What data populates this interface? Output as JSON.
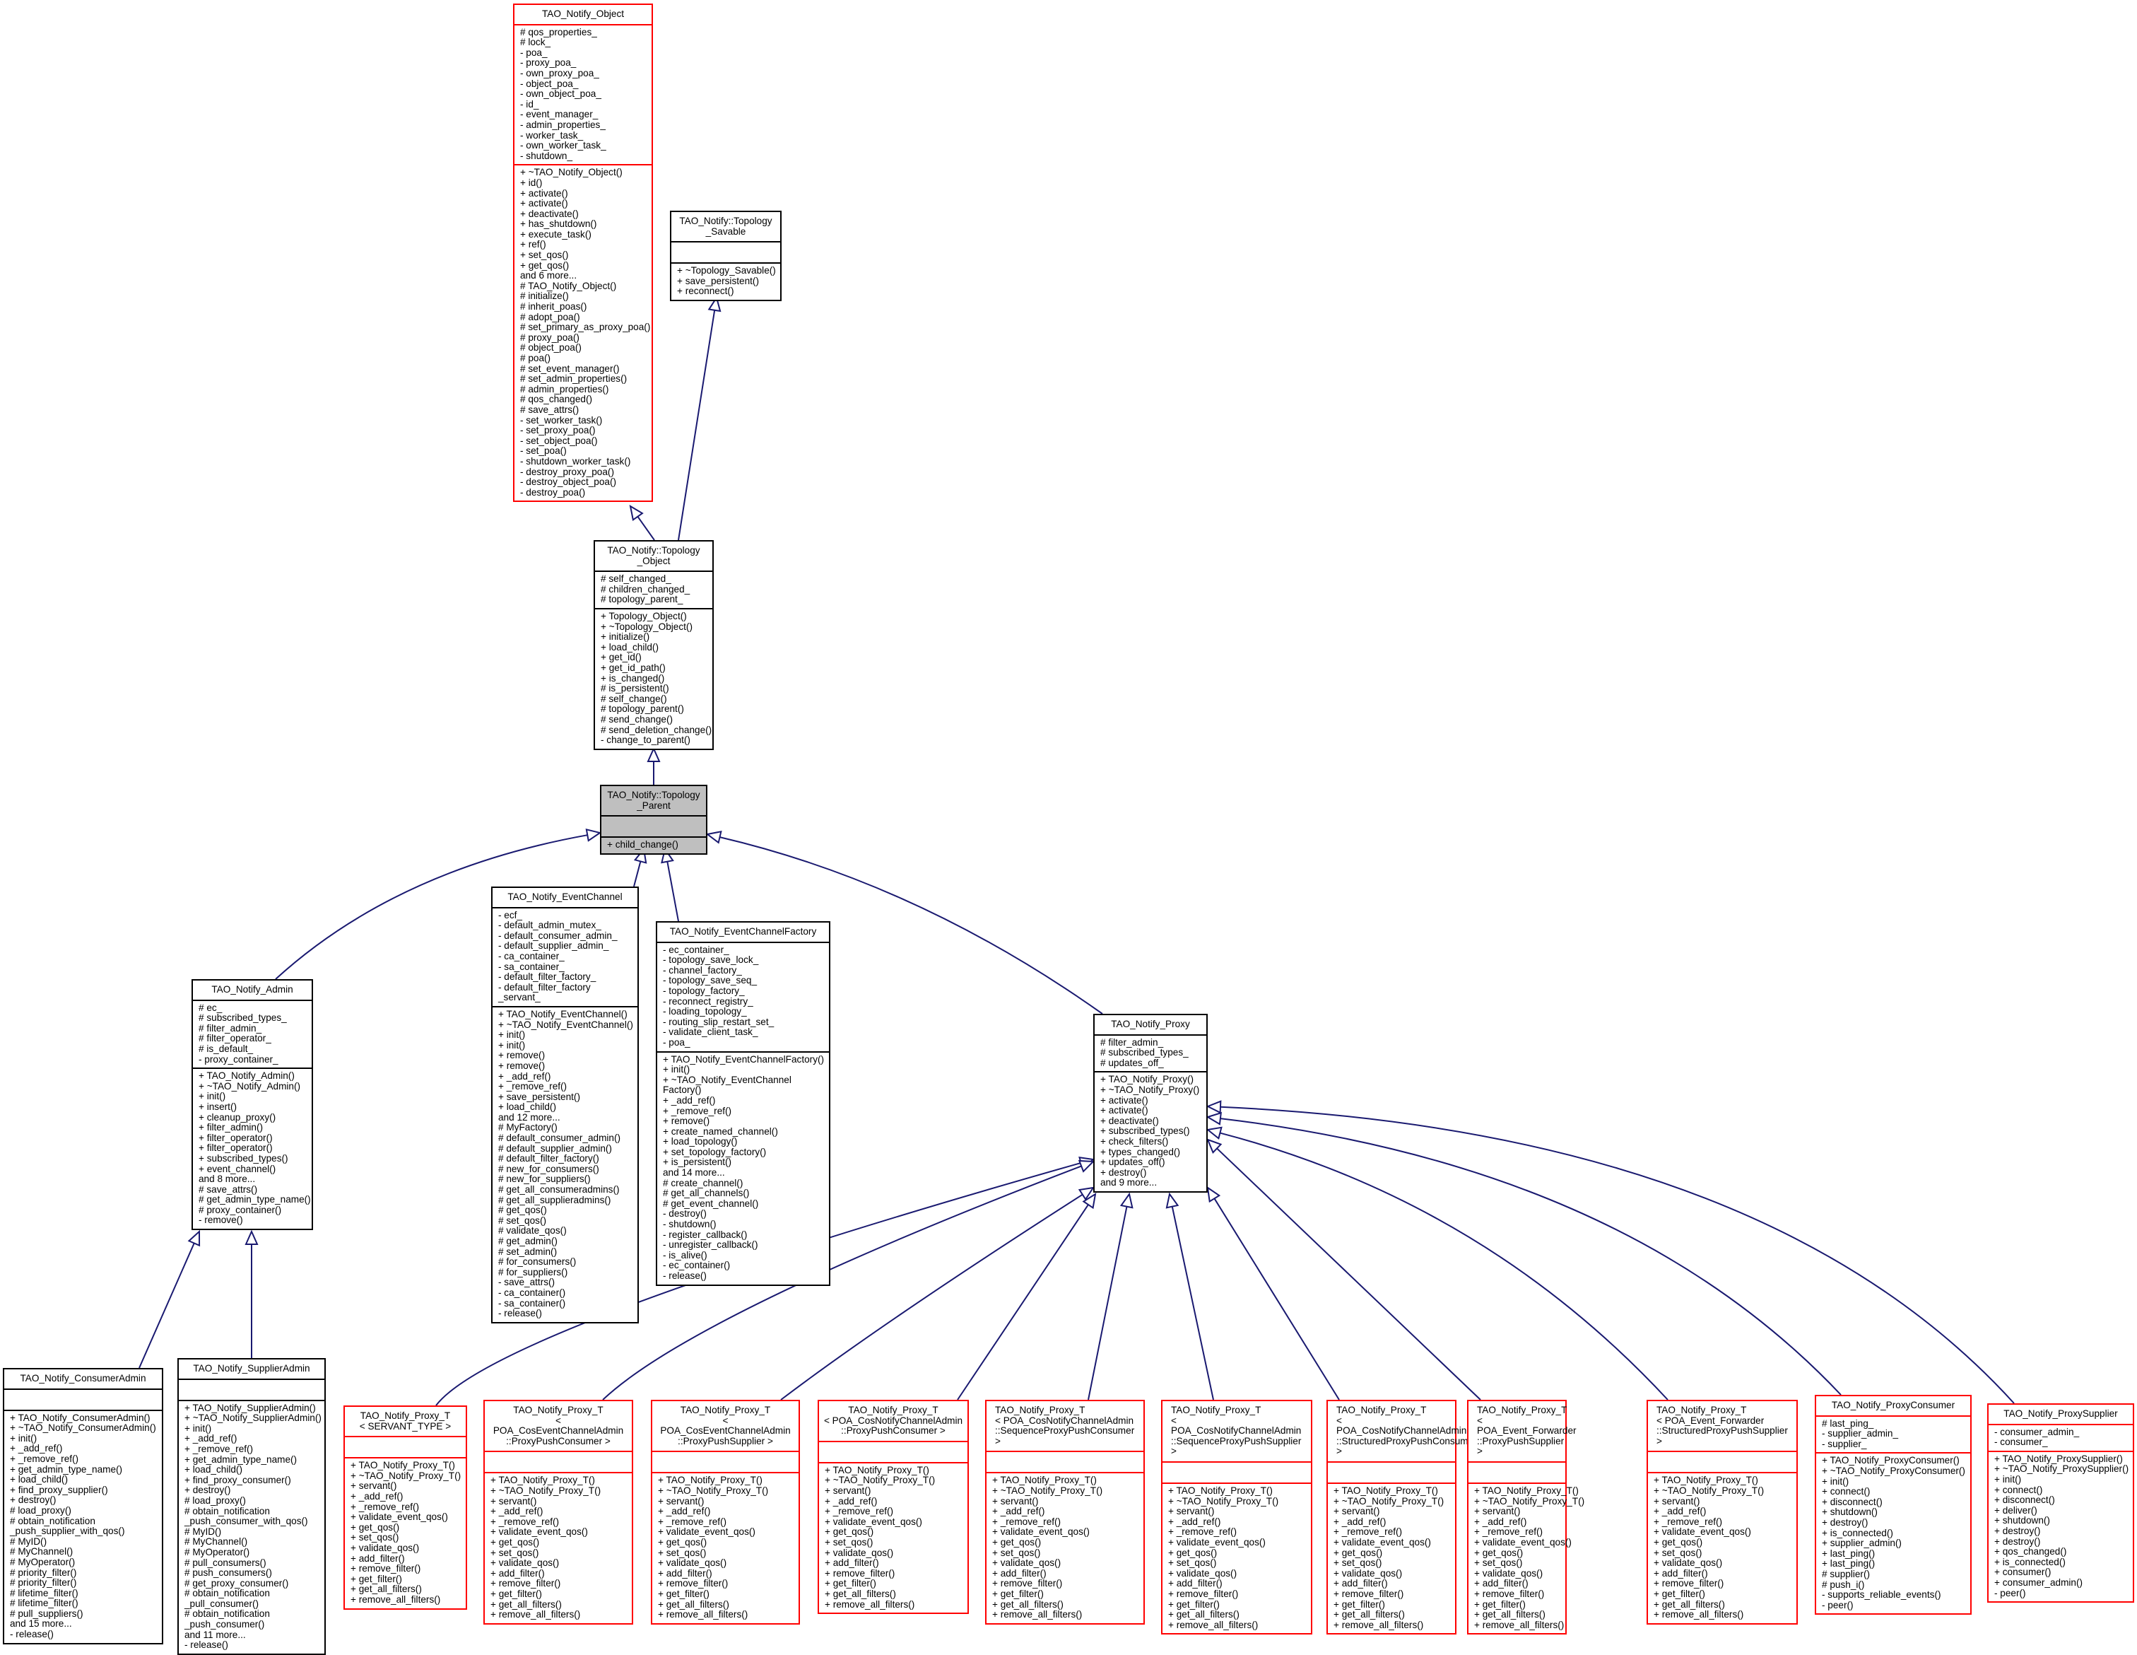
{
  "diagram_title": "Inheritance diagram for TAO_Notify::Topology_Parent",
  "colors": {
    "edge": "#191970",
    "incomplete_border": "#ff0000",
    "complete_border": "#000000",
    "focus_fill": "#bfbfbf"
  },
  "classes": {
    "notify_object": {
      "title": [
        "TAO_Notify_Object"
      ],
      "attributes": [
        "# qos_properties_",
        "# lock_",
        "- poa_",
        "- proxy_poa_",
        "- own_proxy_poa_",
        "- object_poa_",
        "- own_object_poa_",
        "- id_",
        "- event_manager_",
        "- admin_properties_",
        "- worker_task_",
        "- own_worker_task_",
        "- shutdown_"
      ],
      "methods": [
        "+ ~TAO_Notify_Object()",
        "+ id()",
        "+ activate()",
        "+ activate()",
        "+ deactivate()",
        "+ has_shutdown()",
        "+ execute_task()",
        "+ ref()",
        "+ set_qos()",
        "+ get_qos()",
        "and 6 more...",
        "# TAO_Notify_Object()",
        "# initialize()",
        "# inherit_poas()",
        "# adopt_poa()",
        "# set_primary_as_proxy_poa()",
        "# proxy_poa()",
        "# object_poa()",
        "# poa()",
        "# set_event_manager()",
        "# set_admin_properties()",
        "# admin_properties()",
        "# qos_changed()",
        "# save_attrs()",
        "- set_worker_task()",
        "- set_proxy_poa()",
        "- set_object_poa()",
        "- set_poa()",
        "- shutdown_worker_task()",
        "- destroy_proxy_poa()",
        "- destroy_object_poa()",
        "- destroy_poa()"
      ]
    },
    "topology_savable": {
      "title": [
        "TAO_Notify::Topology",
        "_Savable"
      ],
      "attributes": [],
      "methods": [
        "+ ~Topology_Savable()",
        "+ save_persistent()",
        "+ reconnect()"
      ]
    },
    "topology_object": {
      "title": [
        "TAO_Notify::Topology",
        "_Object"
      ],
      "attributes": [
        "# self_changed_",
        "# children_changed_",
        "# topology_parent_"
      ],
      "methods": [
        "+ Topology_Object()",
        "+ ~Topology_Object()",
        "+ initialize()",
        "+ load_child()",
        "+ get_id()",
        "+ get_id_path()",
        "+ is_changed()",
        "# is_persistent()",
        "# self_change()",
        "# topology_parent()",
        "# send_change()",
        "# send_deletion_change()",
        "- change_to_parent()"
      ]
    },
    "topology_parent": {
      "title": [
        "TAO_Notify::Topology",
        "_Parent"
      ],
      "attributes": [],
      "methods": [
        "+ child_change()"
      ]
    },
    "event_channel": {
      "title": [
        "TAO_Notify_EventChannel"
      ],
      "attributes": [
        "- ecf_",
        "- default_admin_mutex_",
        "- default_consumer_admin_",
        "- default_supplier_admin_",
        "- ca_container_",
        "- sa_container_",
        "- default_filter_factory_",
        "- default_filter_factory",
        "_servant_"
      ],
      "methods": [
        "+ TAO_Notify_EventChannel()",
        "+ ~TAO_Notify_EventChannel()",
        "+ init()",
        "+ init()",
        "+ remove()",
        "+ remove()",
        "+ _add_ref()",
        "+ _remove_ref()",
        "+ save_persistent()",
        "+ load_child()",
        "and 12 more...",
        "# MyFactory()",
        "# default_consumer_admin()",
        "# default_supplier_admin()",
        "# default_filter_factory()",
        "# new_for_consumers()",
        "# new_for_suppliers()",
        "# get_all_consumeradmins()",
        "# get_all_supplieradmins()",
        "# get_qos()",
        "# set_qos()",
        "# validate_qos()",
        "# get_admin()",
        "# set_admin()",
        "# for_consumers()",
        "# for_suppliers()",
        "- save_attrs()",
        "- ca_container()",
        "- sa_container()",
        "- release()"
      ]
    },
    "event_channel_factory": {
      "title": [
        "TAO_Notify_EventChannelFactory"
      ],
      "attributes": [
        "- ec_container_",
        "- topology_save_lock_",
        "- channel_factory_",
        "- topology_save_seq_",
        "- topology_factory_",
        "- reconnect_registry_",
        "- loading_topology_",
        "- routing_slip_restart_set_",
        "- validate_client_task_",
        "- poa_"
      ],
      "methods": [
        "+ TAO_Notify_EventChannelFactory()",
        "+ init()",
        "+ ~TAO_Notify_EventChannel",
        "Factory()",
        "+ _add_ref()",
        "+ _remove_ref()",
        "+ remove()",
        "+ create_named_channel()",
        "+ load_topology()",
        "+ set_topology_factory()",
        "+ is_persistent()",
        "and 14 more...",
        "# create_channel()",
        "# get_all_channels()",
        "# get_event_channel()",
        "- destroy()",
        "- shutdown()",
        "- register_callback()",
        "- unregister_callback()",
        "- is_alive()",
        "- ec_container()",
        "- release()"
      ]
    },
    "admin": {
      "title": [
        "TAO_Notify_Admin"
      ],
      "attributes": [
        "# ec_",
        "# subscribed_types_",
        "# filter_admin_",
        "# filter_operator_",
        "# is_default_",
        "- proxy_container_"
      ],
      "methods": [
        "+ TAO_Notify_Admin()",
        "+ ~TAO_Notify_Admin()",
        "+ init()",
        "+ insert()",
        "+ cleanup_proxy()",
        "+ filter_admin()",
        "+ filter_operator()",
        "+ filter_operator()",
        "+ subscribed_types()",
        "+ event_channel()",
        "and 8 more...",
        "# save_attrs()",
        "# get_admin_type_name()",
        "# proxy_container()",
        "- remove()"
      ]
    },
    "consumer_admin": {
      "title": [
        "TAO_Notify_ConsumerAdmin"
      ],
      "attributes": [],
      "methods": [
        "+ TAO_Notify_ConsumerAdmin()",
        "+ ~TAO_Notify_ConsumerAdmin()",
        "+ init()",
        "+ _add_ref()",
        "+ _remove_ref()",
        "+ get_admin_type_name()",
        "+ load_child()",
        "+ find_proxy_supplier()",
        "+ destroy()",
        "# load_proxy()",
        "# obtain_notification",
        "_push_supplier_with_qos()",
        "# MyID()",
        "# MyChannel()",
        "# MyOperator()",
        "# priority_filter()",
        "# priority_filter()",
        "# lifetime_filter()",
        "# lifetime_filter()",
        "# pull_suppliers()",
        "and 15 more...",
        "- release()"
      ]
    },
    "supplier_admin": {
      "title": [
        "TAO_Notify_SupplierAdmin"
      ],
      "attributes": [],
      "methods": [
        "+ TAO_Notify_SupplierAdmin()",
        "+ ~TAO_Notify_SupplierAdmin()",
        "+ init()",
        "+ _add_ref()",
        "+ _remove_ref()",
        "+ get_admin_type_name()",
        "+ load_child()",
        "+ find_proxy_consumer()",
        "+ destroy()",
        "# load_proxy()",
        "# obtain_notification",
        "_push_consumer_with_qos()",
        "# MyID()",
        "# MyChannel()",
        "# MyOperator()",
        "# pull_consumers()",
        "# push_consumers()",
        "# get_proxy_consumer()",
        "# obtain_notification",
        "_pull_consumer()",
        "# obtain_notification",
        "_push_consumer()",
        "and 11 more...",
        "- release()"
      ]
    },
    "proxy": {
      "title": [
        "TAO_Notify_Proxy"
      ],
      "attributes": [
        "# filter_admin_",
        "# subscribed_types_",
        "# updates_off_"
      ],
      "methods": [
        "+ TAO_Notify_Proxy()",
        "+ ~TAO_Notify_Proxy()",
        "+ activate()",
        "+ activate()",
        "+ deactivate()",
        "+ subscribed_types()",
        "+ check_filters()",
        "+ types_changed()",
        "+ updates_off()",
        "+ destroy()",
        "and 9 more..."
      ]
    },
    "proxy_t_servant": {
      "title": [
        "TAO_Notify_Proxy_T",
        "< SERVANT_TYPE >"
      ],
      "attributes": [],
      "methods": [
        "+ TAO_Notify_Proxy_T()",
        "+ ~TAO_Notify_Proxy_T()",
        "+ servant()",
        "+ _add_ref()",
        "+ _remove_ref()",
        "+ validate_event_qos()",
        "+ get_qos()",
        "+ set_qos()",
        "+ validate_qos()",
        "+ add_filter()",
        "+ remove_filter()",
        "+ get_filter()",
        "+ get_all_filters()",
        "+ remove_all_filters()"
      ]
    },
    "proxy_t_cosevent_ppc": {
      "title": [
        "TAO_Notify_Proxy_T",
        "< POA_CosEventChannelAdmin",
        "::ProxyPushConsumer >"
      ],
      "attributes": [],
      "methods": [
        "+ TAO_Notify_Proxy_T()",
        "+ ~TAO_Notify_Proxy_T()",
        "+ servant()",
        "+ _add_ref()",
        "+ _remove_ref()",
        "+ validate_event_qos()",
        "+ get_qos()",
        "+ set_qos()",
        "+ validate_qos()",
        "+ add_filter()",
        "+ remove_filter()",
        "+ get_filter()",
        "+ get_all_filters()",
        "+ remove_all_filters()"
      ]
    },
    "proxy_t_cosevent_pps": {
      "title": [
        "TAO_Notify_Proxy_T",
        "< POA_CosEventChannelAdmin",
        "::ProxyPushSupplier >"
      ],
      "attributes": [],
      "methods": [
        "+ TAO_Notify_Proxy_T()",
        "+ ~TAO_Notify_Proxy_T()",
        "+ servant()",
        "+ _add_ref()",
        "+ _remove_ref()",
        "+ validate_event_qos()",
        "+ get_qos()",
        "+ set_qos()",
        "+ validate_qos()",
        "+ add_filter()",
        "+ remove_filter()",
        "+ get_filter()",
        "+ get_all_filters()",
        "+ remove_all_filters()"
      ]
    },
    "proxy_t_cosnotify_ppc": {
      "title": [
        "TAO_Notify_Proxy_T",
        "< POA_CosNotifyChannelAdmin",
        "::ProxyPushConsumer >"
      ],
      "attributes": [],
      "methods": [
        "+ TAO_Notify_Proxy_T()",
        "+ ~TAO_Notify_Proxy_T()",
        "+ servant()",
        "+ _add_ref()",
        "+ _remove_ref()",
        "+ validate_event_qos()",
        "+ get_qos()",
        "+ set_qos()",
        "+ validate_qos()",
        "+ add_filter()",
        "+ remove_filter()",
        "+ get_filter()",
        "+ get_all_filters()",
        "+ remove_all_filters()"
      ]
    },
    "proxy_t_cosnotify_sppc": {
      "title": [
        "TAO_Notify_Proxy_T",
        "< POA_CosNotifyChannelAdmin",
        "::SequenceProxyPushConsumer >"
      ],
      "attributes": [],
      "methods": [
        "+ TAO_Notify_Proxy_T()",
        "+ ~TAO_Notify_Proxy_T()",
        "+ servant()",
        "+ _add_ref()",
        "+ _remove_ref()",
        "+ validate_event_qos()",
        "+ get_qos()",
        "+ set_qos()",
        "+ validate_qos()",
        "+ add_filter()",
        "+ remove_filter()",
        "+ get_filter()",
        "+ get_all_filters()",
        "+ remove_all_filters()"
      ]
    },
    "proxy_t_cosnotify_spps": {
      "title": [
        "TAO_Notify_Proxy_T",
        "< POA_CosNotifyChannelAdmin",
        "::SequenceProxyPushSupplier >"
      ],
      "attributes": [],
      "methods": [
        "+ TAO_Notify_Proxy_T()",
        "+ ~TAO_Notify_Proxy_T()",
        "+ servant()",
        "+ _add_ref()",
        "+ _remove_ref()",
        "+ validate_event_qos()",
        "+ get_qos()",
        "+ set_qos()",
        "+ validate_qos()",
        "+ add_filter()",
        "+ remove_filter()",
        "+ get_filter()",
        "+ get_all_filters()",
        "+ remove_all_filters()"
      ]
    },
    "proxy_t_cosnotify_stppc": {
      "title": [
        "TAO_Notify_Proxy_T",
        "< POA_CosNotifyChannelAdmin",
        "::StructuredProxyPushConsumer >"
      ],
      "attributes": [],
      "methods": [
        "+ TAO_Notify_Proxy_T()",
        "+ ~TAO_Notify_Proxy_T()",
        "+ servant()",
        "+ _add_ref()",
        "+ _remove_ref()",
        "+ validate_event_qos()",
        "+ get_qos()",
        "+ set_qos()",
        "+ validate_qos()",
        "+ add_filter()",
        "+ remove_filter()",
        "+ get_filter()",
        "+ get_all_filters()",
        "+ remove_all_filters()"
      ]
    },
    "proxy_t_fwd_pps": {
      "title": [
        "TAO_Notify_Proxy_T",
        "< POA_Event_Forwarder",
        "::ProxyPushSupplier >"
      ],
      "attributes": [],
      "methods": [
        "+ TAO_Notify_Proxy_T()",
        "+ ~TAO_Notify_Proxy_T()",
        "+ servant()",
        "+ _add_ref()",
        "+ _remove_ref()",
        "+ validate_event_qos()",
        "+ get_qos()",
        "+ set_qos()",
        "+ validate_qos()",
        "+ add_filter()",
        "+ remove_filter()",
        "+ get_filter()",
        "+ get_all_filters()",
        "+ remove_all_filters()"
      ]
    },
    "proxy_t_fwd_stpps": {
      "title": [
        "TAO_Notify_Proxy_T",
        "< POA_Event_Forwarder",
        "::StructuredProxyPushSupplier >"
      ],
      "attributes": [],
      "methods": [
        "+ TAO_Notify_Proxy_T()",
        "+ ~TAO_Notify_Proxy_T()",
        "+ servant()",
        "+ _add_ref()",
        "+ _remove_ref()",
        "+ validate_event_qos()",
        "+ get_qos()",
        "+ set_qos()",
        "+ validate_qos()",
        "+ add_filter()",
        "+ remove_filter()",
        "+ get_filter()",
        "+ get_all_filters()",
        "+ remove_all_filters()"
      ]
    },
    "proxy_consumer": {
      "title": [
        "TAO_Notify_ProxyConsumer"
      ],
      "attributes": [
        "# last_ping_",
        "- supplier_admin_",
        "- supplier_"
      ],
      "methods": [
        "+ TAO_Notify_ProxyConsumer()",
        "+ ~TAO_Notify_ProxyConsumer()",
        "+ init()",
        "+ connect()",
        "+ disconnect()",
        "+ shutdown()",
        "+ destroy()",
        "+ is_connected()",
        "+ supplier_admin()",
        "+ last_ping()",
        "+ last_ping()",
        "# supplier()",
        "# push_i()",
        "- supports_reliable_events()",
        "- peer()"
      ]
    },
    "proxy_supplier": {
      "title": [
        "TAO_Notify_ProxySupplier"
      ],
      "attributes": [
        "- consumer_admin_",
        "- consumer_"
      ],
      "methods": [
        "+ TAO_Notify_ProxySupplier()",
        "+ ~TAO_Notify_ProxySupplier()",
        "+ init()",
        "+ connect()",
        "+ disconnect()",
        "+ deliver()",
        "+ shutdown()",
        "+ destroy()",
        "+ destroy()",
        "+ qos_changed()",
        "+ is_connected()",
        "+ consumer()",
        "+ consumer_admin()",
        "- peer()"
      ]
    }
  },
  "inheritance": [
    {
      "child": "topology_object",
      "parent": "notify_object"
    },
    {
      "child": "topology_object",
      "parent": "topology_savable"
    },
    {
      "child": "topology_parent",
      "parent": "topology_object"
    },
    {
      "child": "admin",
      "parent": "topology_parent"
    },
    {
      "child": "event_channel",
      "parent": "topology_parent"
    },
    {
      "child": "event_channel_factory",
      "parent": "topology_parent"
    },
    {
      "child": "proxy",
      "parent": "topology_parent"
    },
    {
      "child": "consumer_admin",
      "parent": "admin"
    },
    {
      "child": "supplier_admin",
      "parent": "admin"
    },
    {
      "child": "proxy_t_servant",
      "parent": "proxy"
    },
    {
      "child": "proxy_t_cosevent_ppc",
      "parent": "proxy"
    },
    {
      "child": "proxy_t_cosevent_pps",
      "parent": "proxy"
    },
    {
      "child": "proxy_t_cosnotify_ppc",
      "parent": "proxy"
    },
    {
      "child": "proxy_t_cosnotify_sppc",
      "parent": "proxy"
    },
    {
      "child": "proxy_t_cosnotify_spps",
      "parent": "proxy"
    },
    {
      "child": "proxy_t_cosnotify_stppc",
      "parent": "proxy"
    },
    {
      "child": "proxy_t_fwd_pps",
      "parent": "proxy"
    },
    {
      "child": "proxy_t_fwd_stpps",
      "parent": "proxy"
    },
    {
      "child": "proxy_consumer",
      "parent": "proxy"
    },
    {
      "child": "proxy_supplier",
      "parent": "proxy"
    }
  ]
}
